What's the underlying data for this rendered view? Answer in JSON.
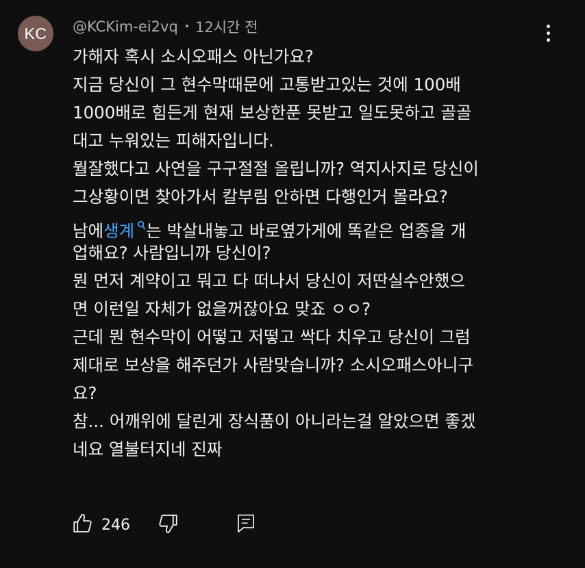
{
  "comment": {
    "avatar_initials": "KC",
    "author": "@KCKim-ei2vq",
    "separator": "•",
    "timestamp": "12시간 전",
    "lines": [
      "가해자 혹시 소시오패스 아닌가요?",
      "지금 당신이 그 현수막때문에 고통받고있는 것에 100배",
      "1000배로 힘든게 현재 보상한푼 못받고 일도못하고 골골",
      "대고 누워있는 피해자입니다.",
      "뭘잘했다고 사연을 구구절절 올립니까? 역지사지로 당신이",
      "그상황이면 찾아가서 칼부림 안하면 다행인거 몰라요?"
    ],
    "search_line_prefix": "남에",
    "search_term": "생계",
    "search_line_suffix": "는 박살내놓고 바로옆가게에 똑같은 업종을 개",
    "lines_after": [
      "업해요? 사람입니까 당신이?",
      "뭔 먼저 계약이고 뭐고 다 떠나서 당신이 저딴실수안했으",
      "면 이런일 자체가 없을꺼잖아요 맞죠 ㅇㅇ?",
      "근데 뭔 현수막이 어떻고 저떻고 싹다 치우고 당신이 그럼",
      "제대로 보상을 해주던가 사람맞습니까? 소시오패스아니구",
      "요?",
      "참... 어깨위에 달린게 장식품이 아니라는걸 알았으면 좋겠",
      "네요 열불터지네 진짜"
    ],
    "like_count": "246",
    "icons": {
      "more": "more-vert-icon",
      "search": "search-icon",
      "like": "thumb-up-icon",
      "dislike": "thumb-down-icon",
      "reply": "reply-icon"
    }
  },
  "colors": {
    "background": "#0f0f0f",
    "text": "#f1f1f1",
    "meta": "#aaaaaa",
    "link": "#3ea6ff",
    "avatar": "#7a5a55"
  }
}
